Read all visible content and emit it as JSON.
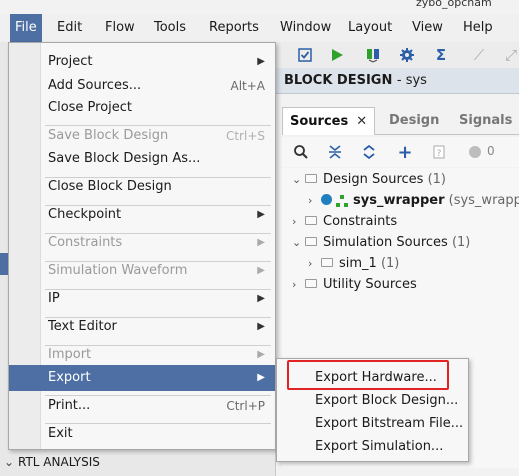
{
  "window": {
    "title_fragment": "zybo_opcnam"
  },
  "menubar": {
    "items": [
      "File",
      "Edit",
      "Flow",
      "Tools",
      "Reports",
      "Window",
      "Layout",
      "View",
      "Help"
    ],
    "active": "File"
  },
  "file_menu": {
    "items": [
      {
        "label": "Project",
        "shortcut": "",
        "submenu": true,
        "enabled": true
      },
      {
        "label": "Add Sources...",
        "shortcut": "Alt+A",
        "submenu": false,
        "enabled": true
      },
      {
        "label": "Close Project",
        "shortcut": "",
        "submenu": false,
        "enabled": true
      },
      {
        "label": "Save Block Design",
        "shortcut": "Ctrl+S",
        "submenu": false,
        "enabled": false
      },
      {
        "label": "Save Block Design As...",
        "shortcut": "",
        "submenu": false,
        "enabled": true
      },
      {
        "label": "Close Block Design",
        "shortcut": "",
        "submenu": false,
        "enabled": true
      },
      {
        "label": "Checkpoint",
        "shortcut": "",
        "submenu": true,
        "enabled": true
      },
      {
        "label": "Constraints",
        "shortcut": "",
        "submenu": true,
        "enabled": false
      },
      {
        "label": "Simulation Waveform",
        "shortcut": "",
        "submenu": true,
        "enabled": false
      },
      {
        "label": "IP",
        "shortcut": "",
        "submenu": true,
        "enabled": true
      },
      {
        "label": "Text Editor",
        "shortcut": "",
        "submenu": true,
        "enabled": true
      },
      {
        "label": "Import",
        "shortcut": "",
        "submenu": true,
        "enabled": false
      },
      {
        "label": "Export",
        "shortcut": "",
        "submenu": true,
        "enabled": true,
        "highlighted": true
      },
      {
        "label": "Print...",
        "shortcut": "Ctrl+P",
        "submenu": false,
        "enabled": true
      },
      {
        "label": "Exit",
        "shortcut": "",
        "submenu": false,
        "enabled": true
      }
    ]
  },
  "export_submenu": {
    "items": [
      "Export Hardware...",
      "Export Block Design...",
      "Export Bitstream File...",
      "Export Simulation..."
    ]
  },
  "block_design": {
    "title": "BLOCK DESIGN",
    "subtitle": "- sys"
  },
  "tabs": {
    "sources": "Sources",
    "design": "Design",
    "signals": "Signals",
    "close_glyph": "✕"
  },
  "sources_toolbar": {
    "count": "0"
  },
  "tree": {
    "design_sources": "Design Sources",
    "design_sources_count": "(1)",
    "wrapper": "sys_wrapper",
    "wrapper_file": "(sys_wrapp",
    "constraints": "Constraints",
    "simulation_sources": "Simulation Sources",
    "simulation_sources_count": "(1)",
    "sim_1": "sim_1",
    "sim_1_count": "(1)",
    "utility_sources": "Utility Sources"
  },
  "left_panel": {
    "rtl_analysis": "RTL ANALYSIS"
  },
  "colors": {
    "menu_highlight": "#4e6fa3",
    "red_outline": "#e02424",
    "wrapper_dot": "#1f7fbf"
  }
}
